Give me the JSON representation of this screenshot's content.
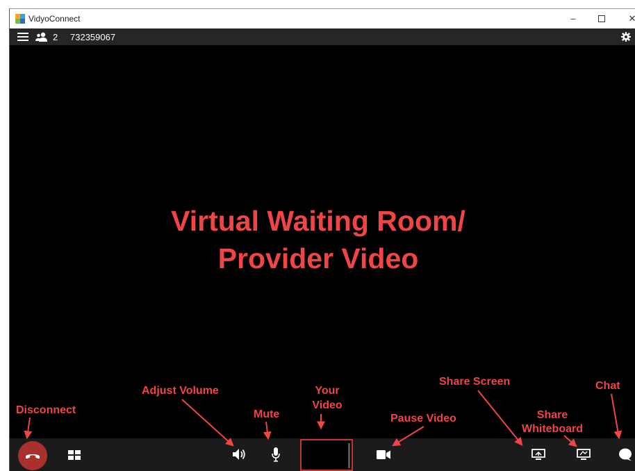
{
  "window": {
    "app_title": "VidyoConnect",
    "minimize_icon": "minimize-icon",
    "maximize_icon": "maximize-icon",
    "close_icon": "close-icon"
  },
  "toolbar": {
    "menu_icon": "hamburger-menu-icon",
    "participants_icon": "participants-icon",
    "participant_count": "2",
    "room_id": "732359067",
    "settings_icon": "gear-icon"
  },
  "stage": {
    "line1": "Virtual Waiting Room/",
    "line2": "Provider Video"
  },
  "controls": {
    "disconnect_icon": "phone-hangup-icon",
    "layout_icon": "layout-grid-icon",
    "volume_icon": "speaker-icon",
    "mic_icon": "microphone-icon",
    "camera_icon": "video-camera-icon",
    "share_screen_icon": "share-screen-icon",
    "whiteboard_icon": "whiteboard-icon",
    "chat_icon": "chat-bubble-icon"
  },
  "annotations": {
    "disconnect": "Disconnect",
    "adjust_volume": "Adjust Volume",
    "mute": "Mute",
    "your_video_1": "Your",
    "your_video_2": "Video",
    "pause_video": "Pause Video",
    "share_screen": "Share Screen",
    "share_whiteboard_1": "Share",
    "share_whiteboard_2": "Whiteboard",
    "chat": "Chat"
  },
  "colors": {
    "annotation_red": "#ef4546",
    "disconnect_red": "#a9312d",
    "selfview_border": "#c0392b"
  }
}
